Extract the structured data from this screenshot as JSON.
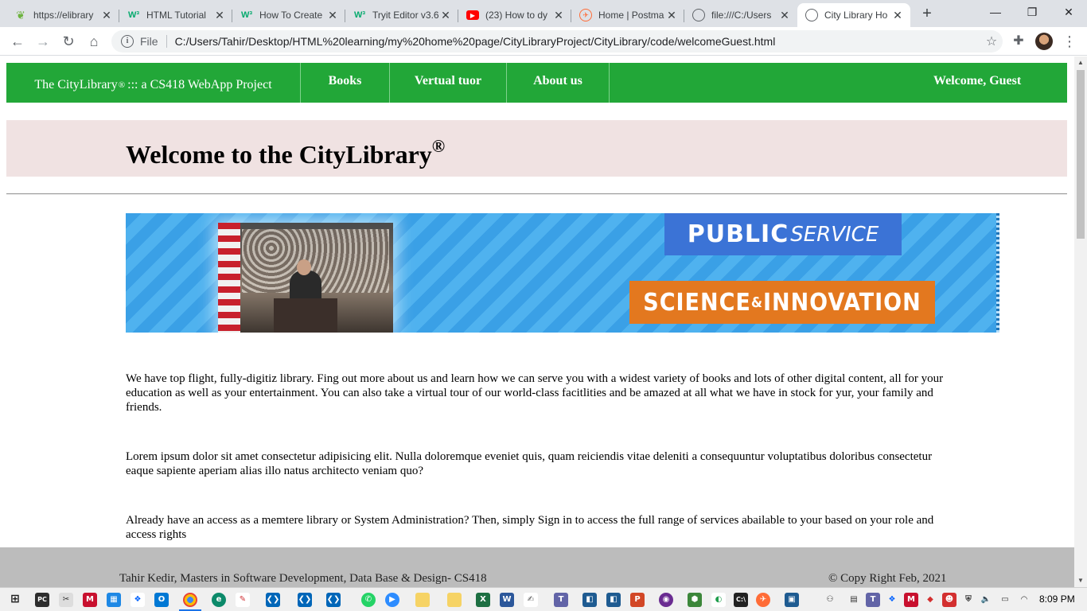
{
  "browser": {
    "tabs": [
      {
        "title": "https://elibrary",
        "favicon": "leaf-icon",
        "color": "#6db33f"
      },
      {
        "title": "HTML Tutorial",
        "favicon": "w3schools-icon",
        "color": "#04aa6d"
      },
      {
        "title": "How To Create",
        "favicon": "w3schools-icon",
        "color": "#04aa6d"
      },
      {
        "title": "Tryit Editor v3.6",
        "favicon": "w3schools-icon",
        "color": "#04aa6d"
      },
      {
        "title": "(23) How to dy",
        "favicon": "youtube-icon",
        "color": "#ff0000"
      },
      {
        "title": "Home | Postma",
        "favicon": "postman-icon",
        "color": "#ff6c37"
      },
      {
        "title": "file:///C:/Users",
        "favicon": "globe-icon",
        "color": "#5f6368"
      },
      {
        "title": "City Library Ho",
        "favicon": "globe-icon",
        "color": "#5f6368"
      }
    ],
    "url_scheme": "File",
    "url": "C:/Users/Tahir/Desktop/HTML%20learning/my%20home%20page/CityLibraryProject/CityLibrary/code/welcomeGuest.html"
  },
  "site": {
    "brand": "The CityLibrary",
    "brand_mark": "®",
    "brand_suffix": "::: a CS418 WebApp Project",
    "nav": [
      {
        "label": "Books"
      },
      {
        "label": "Vertual tuor"
      },
      {
        "label": "About us"
      }
    ],
    "welcome": "Welcome, Guest",
    "accent": "#22a738"
  },
  "hero": {
    "title": "Welcome to the CityLibrary",
    "mark": "®",
    "background": "#f0e2e2"
  },
  "banner": {
    "public": "PUBLIC",
    "service": "SERVICE",
    "science": "SCIENCE",
    "amp": "&",
    "innovation": "INNOVATION"
  },
  "content": {
    "p1": "We have top flight, fully-digitiz library. Fing out more about us and learn how we can serve you with a widest variety of books and lots of other digital content, all for your education as well as your entertainment. You can also take a virtual tour of our world-class facitlities and be amazed at all what we have in stock for yur, your family and friends.",
    "p2": "Lorem ipsum dolor sit amet consectetur adipisicing elit. Nulla doloremque eveniet quis, quam reiciendis vitae deleniti a consequuntur voluptatibus doloribus consectetur eaque sapiente aperiam alias illo natus architecto veniam quo?",
    "p3": "Already have an access as a memtere library or System Administration? Then, simply Sign in to access the full range of services abailable to your based on your role and access rights"
  },
  "footer": {
    "author": "Tahir Kedir, Masters in Software Development, Data Base & Design- CS418",
    "copyright": "© Copy Right Feb, 2021"
  },
  "taskbar": {
    "time": "8:09 PM"
  }
}
